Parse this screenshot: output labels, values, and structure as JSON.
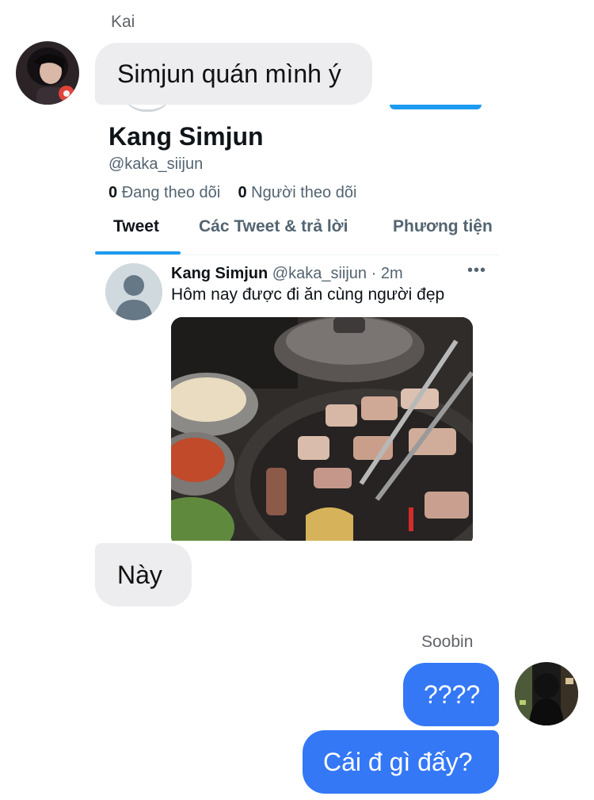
{
  "messages": {
    "kai": {
      "name": "Kai",
      "text1": "Simjun quán mình ý",
      "text2": "Này"
    },
    "soobin": {
      "name": "Soobin",
      "text1": "????",
      "text2": "Cái đ gì đấy?"
    }
  },
  "screenshot": {
    "profile": {
      "name": "Kang Simjun",
      "handle": "@kaka_siijun",
      "following_count": "0",
      "following_label": "Đang theo dõi",
      "followers_count": "0",
      "followers_label": "Người theo dõi"
    },
    "tabs": [
      "Tweet",
      "Các Tweet & trả lời",
      "Phương tiện"
    ],
    "tweet": {
      "author": "Kang Simjun",
      "handle_time": "@kaka_siijun · 2m",
      "more": "•••",
      "text": "Hôm nay được đi ăn cùng người đẹp"
    }
  },
  "colors": {
    "incoming_bubble": "#ededf0",
    "outgoing_bubble": "#3478f6",
    "twitter_blue": "#1d9bf0"
  }
}
